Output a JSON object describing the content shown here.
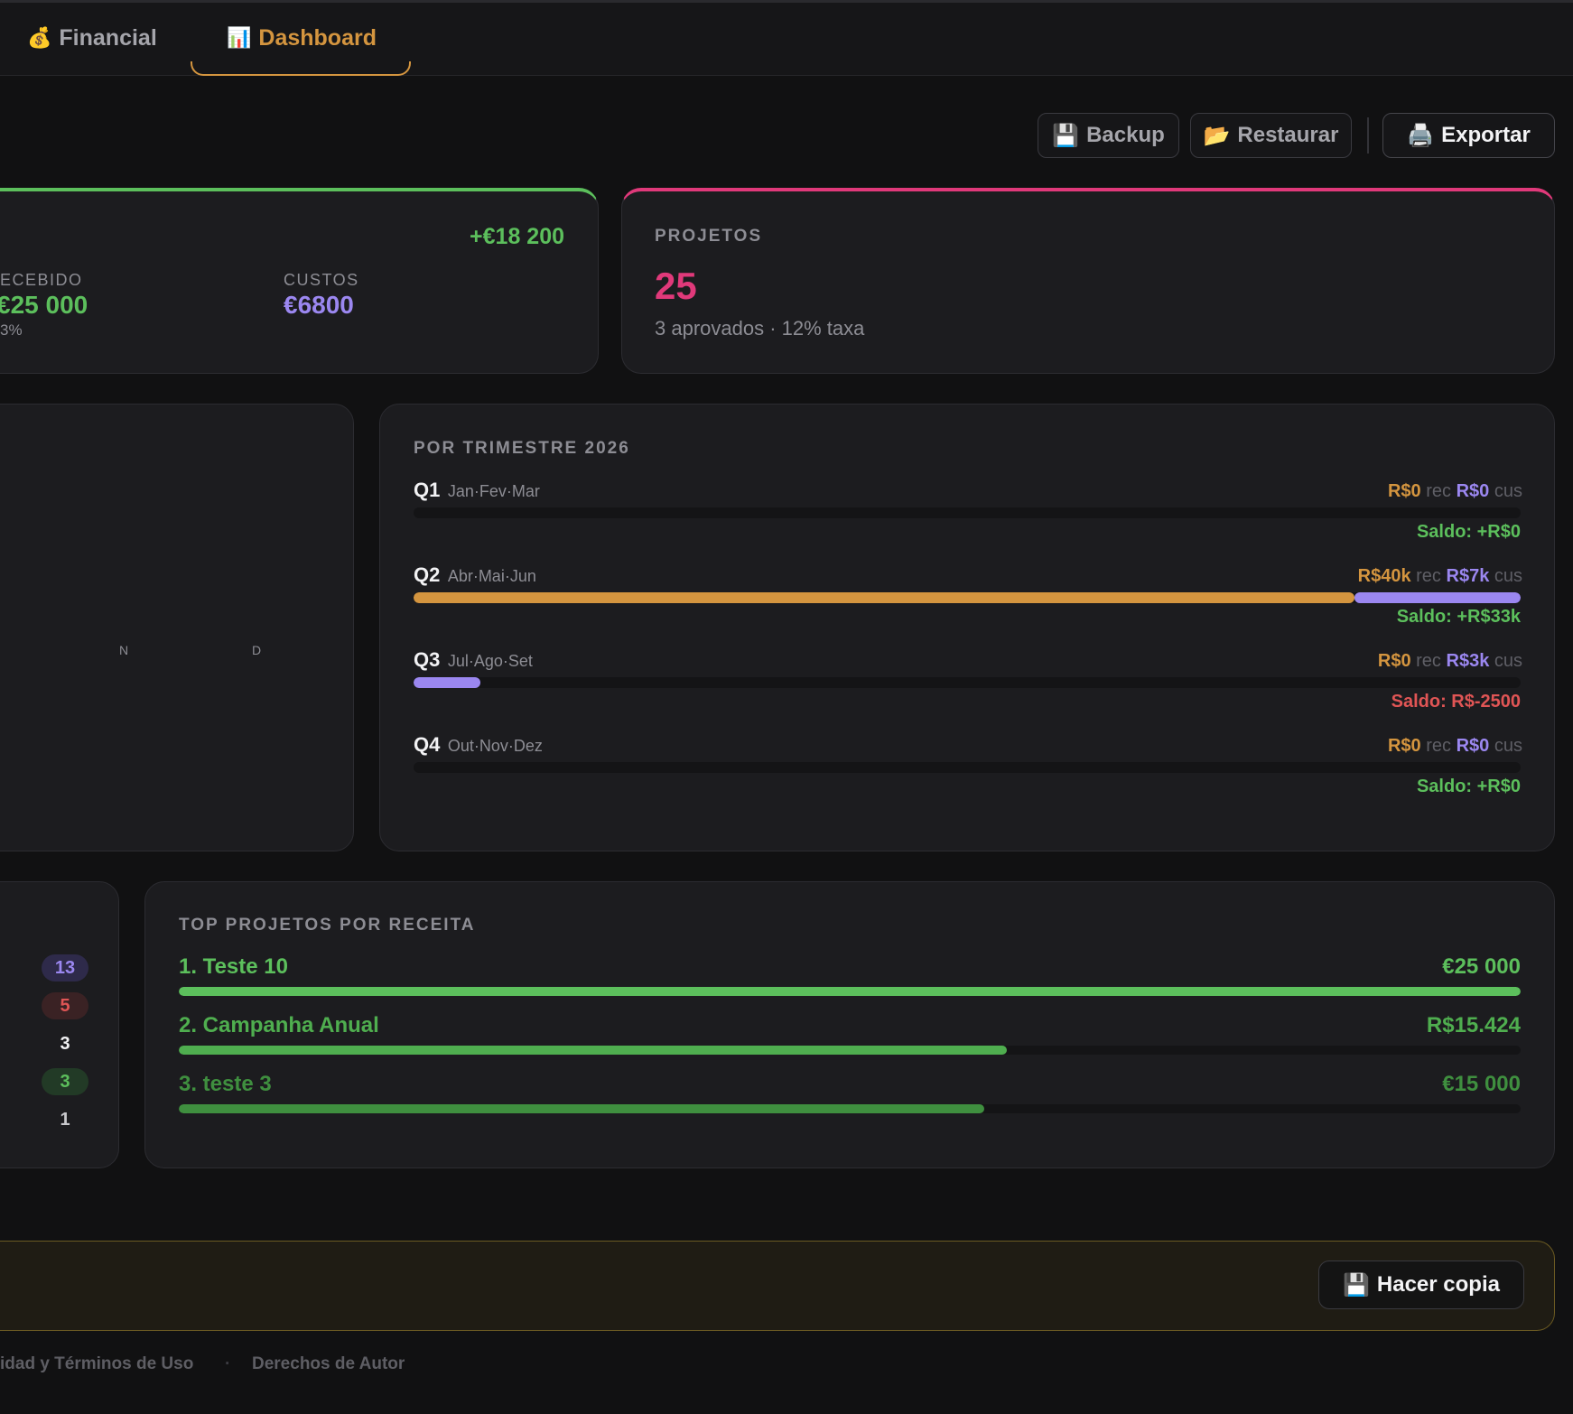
{
  "nav": {
    "tabs": [
      {
        "icon": "💰",
        "label": "Financial"
      },
      {
        "icon": "📊",
        "label": "Dashboard"
      }
    ]
  },
  "actions": {
    "backup": {
      "icon": "💾",
      "label": "Backup"
    },
    "restore": {
      "icon": "📂",
      "label": "Restaurar"
    },
    "export": {
      "icon": "🖨️",
      "label": "Exportar"
    }
  },
  "financial_card": {
    "balance": "+€18 200",
    "received_label": "ECEBIDO",
    "received_value": "€25 000",
    "received_sub": "3%",
    "costs_label": "CUSTOS",
    "costs_value": "€6800",
    "accent": "#5cbf5c"
  },
  "projects_card": {
    "label": "PROJETOS",
    "value": "25",
    "sub": "3 aprovados · 12% taxa",
    "accent": "#e0397a"
  },
  "monthly_chart": {
    "month_labels": [
      "N",
      "D"
    ]
  },
  "quarters": {
    "title": "POR TRIMESTRE 2026",
    "rec_word": "rec",
    "cus_word": "cus",
    "items": [
      {
        "name": "Q1",
        "months": "Jan·Fev·Mar",
        "rec": "R$0",
        "cus": "R$0",
        "saldo": "Saldo: +R$0",
        "rec_fraction": 0,
        "cus_fraction": 0
      },
      {
        "name": "Q2",
        "months": "Abr·Mai·Jun",
        "rec": "R$40k",
        "cus": "R$7k",
        "saldo": "Saldo: +R$33k",
        "rec_fraction": 0.85,
        "cus_fraction": 0.15
      },
      {
        "name": "Q3",
        "months": "Jul·Ago·Set",
        "rec": "R$0",
        "cus": "R$3k",
        "saldo": "Saldo: R$-2500",
        "rec_fraction": 0,
        "cus_fraction": 0.06
      },
      {
        "name": "Q4",
        "months": "Out·Nov·Dez",
        "rec": "R$0",
        "cus": "R$0",
        "saldo": "Saldo: +R$0",
        "rec_fraction": 0,
        "cus_fraction": 0
      }
    ]
  },
  "status_counts": [
    {
      "value": "13",
      "color": "#9b87f0",
      "bg": "#2e2a4a"
    },
    {
      "value": "5",
      "color": "#e05555",
      "bg": "#3a2224"
    },
    {
      "value": "3",
      "color": "#f2f2f4",
      "bg": "transparent"
    },
    {
      "value": "3",
      "color": "#5cbf5c",
      "bg": "#223a26"
    },
    {
      "value": "1",
      "color": "#c8c8cc",
      "bg": "transparent"
    }
  ],
  "top_projects": {
    "title": "TOP PROJETOS POR RECEITA",
    "items": [
      {
        "name": "1. Teste 10",
        "value": "€25 000",
        "fraction": 1.0,
        "color": "#5cbf5c"
      },
      {
        "name": "2. Campanha Anual",
        "value": "R$15.424",
        "fraction": 0.617,
        "color": "#4fae4f"
      },
      {
        "name": "3. teste 3",
        "value": "€15 000",
        "fraction": 0.6,
        "color": "#3f8f3f"
      }
    ]
  },
  "backup_banner": {
    "button_icon": "💾",
    "button_label": "Hacer copia"
  },
  "footer": {
    "link1": "idad y Términos de Uso",
    "separator": "·",
    "link2": "Derechos de Autor"
  }
}
